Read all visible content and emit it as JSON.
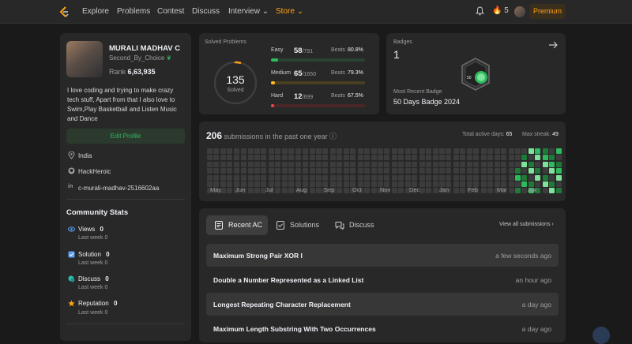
{
  "nav": {
    "links": [
      "Explore",
      "Problems",
      "Contest",
      "Discuss",
      "Interview",
      "Store"
    ],
    "streak": "5",
    "premium": "Premium"
  },
  "profile": {
    "name": "MURALI MADHAV C",
    "username": "Second_By_Choice",
    "rank_label": "Rank",
    "rank": "6,63,935",
    "bio": [
      "I love coding and trying to make crazy",
      "tech stuff, Apart from that I also love to",
      "Swim,Play Basketball and Listen Music",
      "and Dance"
    ],
    "edit": "Edit Profile",
    "location": "India",
    "github": "HackHeroic",
    "linkedin": "c-murali-madhav-2516602aa"
  },
  "community": {
    "title": "Community Stats",
    "items": [
      {
        "label": "Views",
        "value": "0",
        "sub": "Last week 0",
        "color": "#5aa0f2"
      },
      {
        "label": "Solution",
        "value": "0",
        "sub": "Last week 0",
        "color": "#5aa0f2"
      },
      {
        "label": "Discuss",
        "value": "0",
        "sub": "Last week 0",
        "color": "#2cbbb0"
      },
      {
        "label": "Reputation",
        "value": "0",
        "sub": "Last week 0",
        "color": "#ffa116"
      }
    ]
  },
  "solved": {
    "title": "Solved Problems",
    "count": "135",
    "label": "Solved",
    "rows": [
      {
        "name": "Easy",
        "solved": "58",
        "total": "/791",
        "beats": "Beats",
        "pct": "80.8%",
        "frac": 0.073,
        "color": "#2cbb5d",
        "track": "#2a4230"
      },
      {
        "name": "Medium",
        "solved": "65",
        "total": "/1650",
        "beats": "Beats",
        "pct": "79.3%",
        "frac": 0.039,
        "color": "#ffc01e",
        "track": "#4a3f21"
      },
      {
        "name": "Hard",
        "solved": "12",
        "total": "/699",
        "beats": "Beats",
        "pct": "67.5%",
        "frac": 0.017,
        "color": "#ef4743",
        "track": "#4a2626"
      }
    ]
  },
  "badges": {
    "title": "Badges",
    "count": "1",
    "recent_label": "Most Recent Badge",
    "recent": "50 Days Badge 2024",
    "badge_text": "50"
  },
  "submissions": {
    "count": "206",
    "text": "submissions in the past one year",
    "active_label": "Total active days:",
    "active": "65",
    "streak_label": "Max streak:",
    "streak": "49",
    "months": [
      "May",
      "Jun",
      "Jul",
      "Aug",
      "Sep",
      "Oct",
      "Nov",
      "Dec",
      "Jan",
      "Feb",
      "Mar",
      "Apr"
    ]
  },
  "recent": {
    "tabs": [
      "Recent AC",
      "Solutions",
      "Discuss"
    ],
    "view_all": "View all submissions",
    "rows": [
      {
        "title": "Maximum Strong Pair XOR I",
        "time": "a few seconds ago"
      },
      {
        "title": "Double a Number Represented as a Linked List",
        "time": "an hour ago"
      },
      {
        "title": "Longest Repeating Character Replacement",
        "time": "a day ago"
      },
      {
        "title": "Maximum Length Substring With Two Occurrences",
        "time": "a day ago"
      }
    ]
  }
}
